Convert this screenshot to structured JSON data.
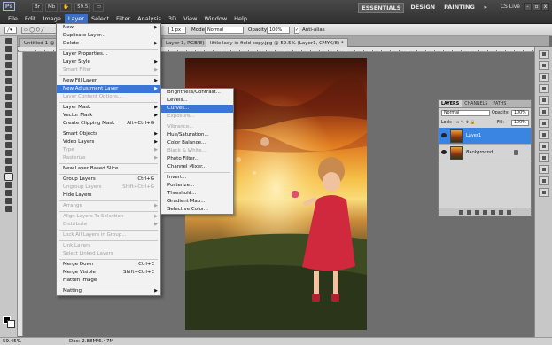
{
  "app": {
    "logo": "Ps",
    "menubar": [
      "File",
      "Edit",
      "Image",
      "Layer",
      "Select",
      "Filter",
      "Analysis",
      "3D",
      "View",
      "Window",
      "Help"
    ],
    "active_menu": "Layer",
    "zoom_badge": "59.5",
    "workspaces": [
      "ESSENTIALS",
      "DESIGN",
      "PAINTING",
      "»"
    ],
    "cs_live": "CS Live",
    "window_controls": [
      "-",
      "▫",
      "x"
    ]
  },
  "options": {
    "size_value": "1 px",
    "mode_label": "Mode:",
    "mode_value": "Normal",
    "opacity_label": "Opacity:",
    "opacity_value": "100%",
    "antialias_label": "Anti-alias"
  },
  "tabs": [
    {
      "label": "Untitled-1 @"
    },
    {
      "label": "Layer 1, RGB/8) *"
    },
    {
      "label": "little lady in field copy.jpg @ 59.5% (Layer1, CMYK/8) *"
    }
  ],
  "layer_menu": [
    {
      "label": "New",
      "arrow": true
    },
    {
      "label": "Duplicate Layer..."
    },
    {
      "label": "Delete",
      "arrow": true
    },
    {
      "sep": true
    },
    {
      "label": "Layer Properties..."
    },
    {
      "label": "Layer Style",
      "arrow": true
    },
    {
      "label": "Smart Filter",
      "disabled": true,
      "arrow": true
    },
    {
      "sep": true
    },
    {
      "label": "New Fill Layer",
      "arrow": true
    },
    {
      "label": "New Adjustment Layer",
      "arrow": true,
      "highlight": true
    },
    {
      "label": "Layer Content Options...",
      "disabled": true
    },
    {
      "sep": true
    },
    {
      "label": "Layer Mask",
      "arrow": true
    },
    {
      "label": "Vector Mask",
      "arrow": true
    },
    {
      "label": "Create Clipping Mask",
      "shortcut": "Alt+Ctrl+G"
    },
    {
      "sep": true
    },
    {
      "label": "Smart Objects",
      "arrow": true
    },
    {
      "label": "Video Layers",
      "arrow": true
    },
    {
      "label": "Type",
      "disabled": true,
      "arrow": true
    },
    {
      "label": "Rasterize",
      "disabled": true,
      "arrow": true
    },
    {
      "sep": true
    },
    {
      "label": "New Layer Based Slice"
    },
    {
      "sep": true
    },
    {
      "label": "Group Layers",
      "shortcut": "Ctrl+G"
    },
    {
      "label": "Ungroup Layers",
      "shortcut": "Shift+Ctrl+G",
      "disabled": true
    },
    {
      "label": "Hide Layers"
    },
    {
      "sep": true
    },
    {
      "label": "Arrange",
      "disabled": true,
      "arrow": true
    },
    {
      "sep": true
    },
    {
      "label": "Align Layers To Selection",
      "disabled": true,
      "arrow": true
    },
    {
      "label": "Distribute",
      "disabled": true,
      "arrow": true
    },
    {
      "sep": true
    },
    {
      "label": "Lock All Layers in Group...",
      "disabled": true
    },
    {
      "sep": true
    },
    {
      "label": "Link Layers",
      "disabled": true
    },
    {
      "label": "Select Linked Layers",
      "disabled": true
    },
    {
      "sep": true
    },
    {
      "label": "Merge Down",
      "shortcut": "Ctrl+E"
    },
    {
      "label": "Merge Visible",
      "shortcut": "Shift+Ctrl+E"
    },
    {
      "label": "Flatten Image"
    },
    {
      "sep": true
    },
    {
      "label": "Matting",
      "arrow": true
    }
  ],
  "adjust_menu": [
    {
      "label": "Brightness/Contrast..."
    },
    {
      "label": "Levels..."
    },
    {
      "label": "Curves...",
      "highlight": true
    },
    {
      "label": "Exposure...",
      "disabled": true
    },
    {
      "sep": true
    },
    {
      "label": "Vibrance...",
      "disabled": true
    },
    {
      "label": "Hue/Saturation..."
    },
    {
      "label": "Color Balance..."
    },
    {
      "label": "Black & White...",
      "disabled": true
    },
    {
      "label": "Photo Filter..."
    },
    {
      "label": "Channel Mixer..."
    },
    {
      "sep": true
    },
    {
      "label": "Invert..."
    },
    {
      "label": "Posterize..."
    },
    {
      "label": "Threshold..."
    },
    {
      "label": "Gradient Map..."
    },
    {
      "label": "Selective Color..."
    }
  ],
  "layers_panel": {
    "tabs": [
      "LAYERS",
      "CHANNELS",
      "PATHS"
    ],
    "blend_mode": "Normal",
    "opacity_label": "Opacity:",
    "opacity_value": "100%",
    "lock_label": "Lock:",
    "fill_label": "Fill:",
    "fill_value": "100%",
    "layers": [
      {
        "name": "Layer1",
        "active": true
      },
      {
        "name": "Background",
        "active": false,
        "locked": true
      }
    ]
  },
  "status": {
    "zoom": "59.45%",
    "doc": "Doc: 2.88M/6.47M"
  },
  "colors": {
    "menu_highlight": "#3a75d8",
    "layer_selected": "#3a84e2"
  }
}
